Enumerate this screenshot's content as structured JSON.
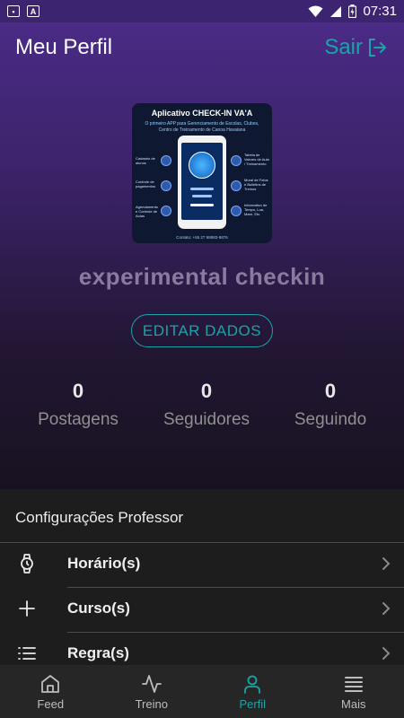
{
  "status_bar": {
    "time": "07:31",
    "icons": [
      "image-icon",
      "a-icon",
      "wifi-icon",
      "signal-icon",
      "battery-icon"
    ]
  },
  "header": {
    "title": "Meu Perfil",
    "logout_label": "Sair"
  },
  "profile": {
    "image": {
      "title": "Aplicativo CHECK-IN VA'A",
      "subtitle": "O primeiro APP para Gerenciamento de Escolas, Clubes, Centro de Treinamento de Canoa Havaiana",
      "features_left": [
        "Cadastro de alunos",
        "Controle de pagamentos",
        "Agendamento e Controle de Aulas"
      ],
      "features_right": [
        "Tabela de Valores de Aula / Treinamento",
        "Mural de Fotos e Bulletins de Treinos",
        "Informativo de Tempo, Lua, Mare, Etc."
      ],
      "footer": "Contato: +55 27 99883-9876"
    },
    "name": "experimental checkin",
    "edit_label": "EDITAR DADOS"
  },
  "stats": [
    {
      "value": "0",
      "label": "Postagens"
    },
    {
      "value": "0",
      "label": "Seguidores"
    },
    {
      "value": "0",
      "label": "Seguindo"
    }
  ],
  "settings": {
    "title": "Configurações Professor",
    "items": [
      {
        "label": "Horário(s)",
        "icon": "watch-icon"
      },
      {
        "label": "Curso(s)",
        "icon": "plus-icon"
      },
      {
        "label": "Regra(s)",
        "icon": "list-icon"
      }
    ]
  },
  "nav": [
    {
      "label": "Feed",
      "icon": "home-icon",
      "active": false
    },
    {
      "label": "Treino",
      "icon": "activity-icon",
      "active": false
    },
    {
      "label": "Perfil",
      "icon": "user-icon",
      "active": true
    },
    {
      "label": "Mais",
      "icon": "menu-icon",
      "active": false
    }
  ],
  "colors": {
    "accent": "#1aa3a8",
    "header_top": "#4a2b86",
    "background": "#151515"
  }
}
